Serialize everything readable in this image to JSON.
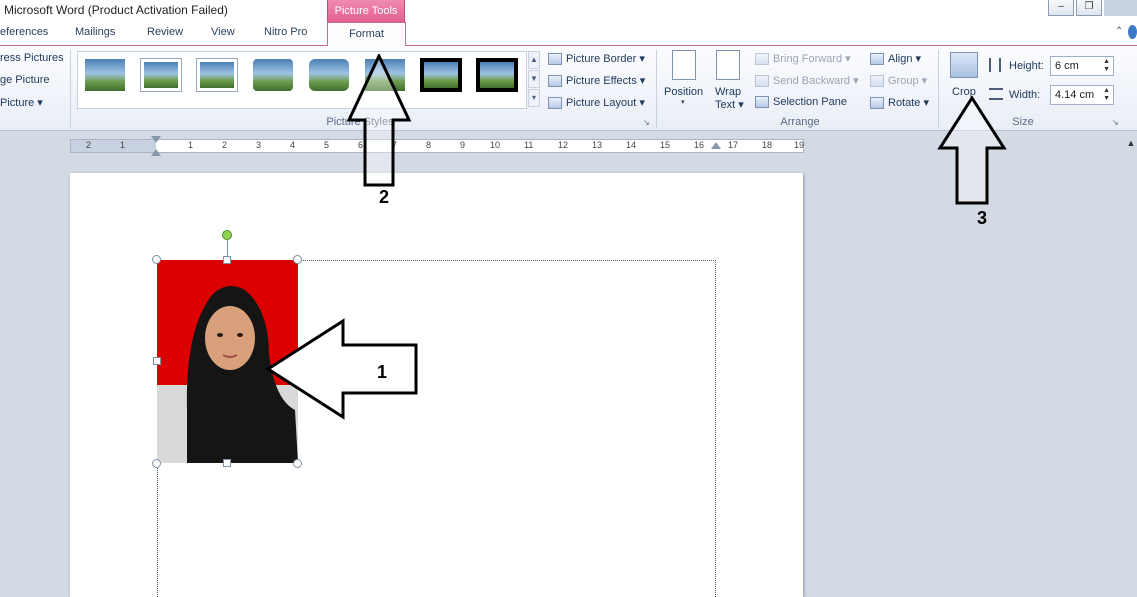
{
  "window": {
    "title": "Microsoft Word (Product Activation Failed)",
    "context_header": "Picture Tools",
    "minimize": "–",
    "restore": "❐"
  },
  "tabs": [
    "eferences",
    "Mailings",
    "Review",
    "View",
    "Nitro Pro",
    "Format"
  ],
  "adjust": {
    "compress": "ress Pictures",
    "change": "ge Picture",
    "reset": "Picture"
  },
  "picture_styles": {
    "label": "Picture Styles",
    "border": "Picture Border",
    "effects": "Picture Effects",
    "layout": "Picture Layout"
  },
  "arrange": {
    "label": "Arrange",
    "position": "Position",
    "wrap_line1": "Wrap",
    "wrap_line2": "Text",
    "bring_forward": "Bring Forward",
    "send_backward": "Send Backward",
    "selection_pane": "Selection Pane",
    "align": "Align",
    "group": "Group",
    "rotate": "Rotate"
  },
  "size": {
    "label": "Size",
    "crop": "Crop",
    "height_label": "Height:",
    "height_value": "6 cm",
    "width_label": "Width:",
    "width_value": "4.14 cm"
  },
  "ruler": [
    "2",
    "1",
    "1",
    "2",
    "3",
    "4",
    "5",
    "6",
    "7",
    "8",
    "9",
    "10",
    "11",
    "12",
    "13",
    "14",
    "15",
    "16",
    "17",
    "18",
    "19"
  ],
  "annotations": [
    "1",
    "2",
    "3"
  ],
  "colors": {
    "context_tab": "#e0608f",
    "photo_background": "#dd0000",
    "rotation_handle": "#8fd44f"
  }
}
